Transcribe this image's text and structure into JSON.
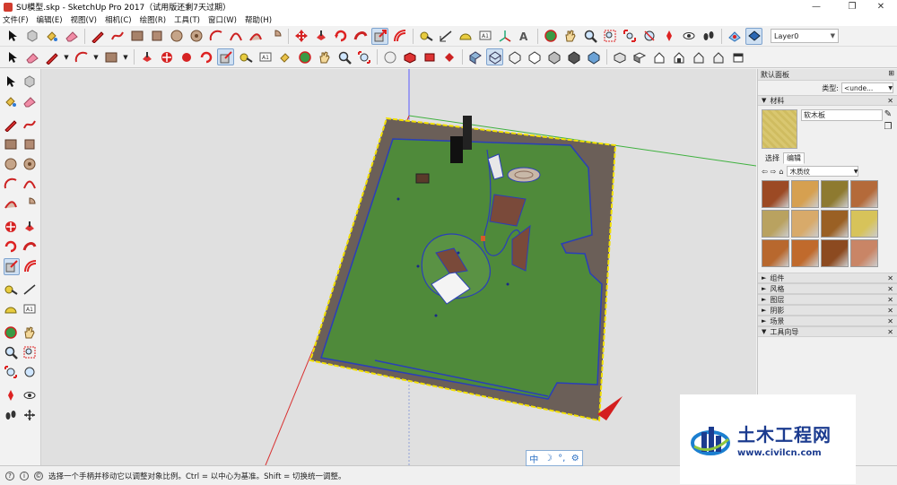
{
  "window": {
    "title": "SU模型.skp - SketchUp Pro 2017（试用版还剩7天过期）",
    "controls": [
      "—",
      "❐",
      "✕"
    ]
  },
  "menu": [
    "文件(F)",
    "编辑(E)",
    "视图(V)",
    "相机(C)",
    "绘图(R)",
    "工具(T)",
    "窗口(W)",
    "帮助(H)"
  ],
  "toolbar": {
    "layer_value": "Layer0"
  },
  "panel": {
    "title": "默认面板",
    "type_label": "类型:",
    "type_value": "<unde...",
    "materials": {
      "section": "材料",
      "name_value": "软木板",
      "tab_select": "选择",
      "tab_edit": "编辑",
      "library_value": "木质纹",
      "swatch_colors": [
        "#9c4a24",
        "#d6a050",
        "#8e7a30",
        "#b46a3a",
        "#b9a260",
        "#d8aa6a",
        "#9a6024",
        "#d7c35a",
        "#b8682e",
        "#c06a2c",
        "#8c4a20",
        "#c98566"
      ]
    },
    "collapsed_sections": [
      "组件",
      "风格",
      "图层",
      "阴影",
      "场景",
      "工具向导"
    ]
  },
  "status": {
    "message": "选择一个手柄并移动它以调整对象比例。Ctrl = 以中心为基准。Shift = 切换统一调整。"
  },
  "ime": {
    "mode": "中",
    "moon": "☽",
    "punct": "°,",
    "gear": "⚙"
  },
  "watermark": {
    "text": "土木工程网",
    "url": "www.civilcn.com"
  }
}
